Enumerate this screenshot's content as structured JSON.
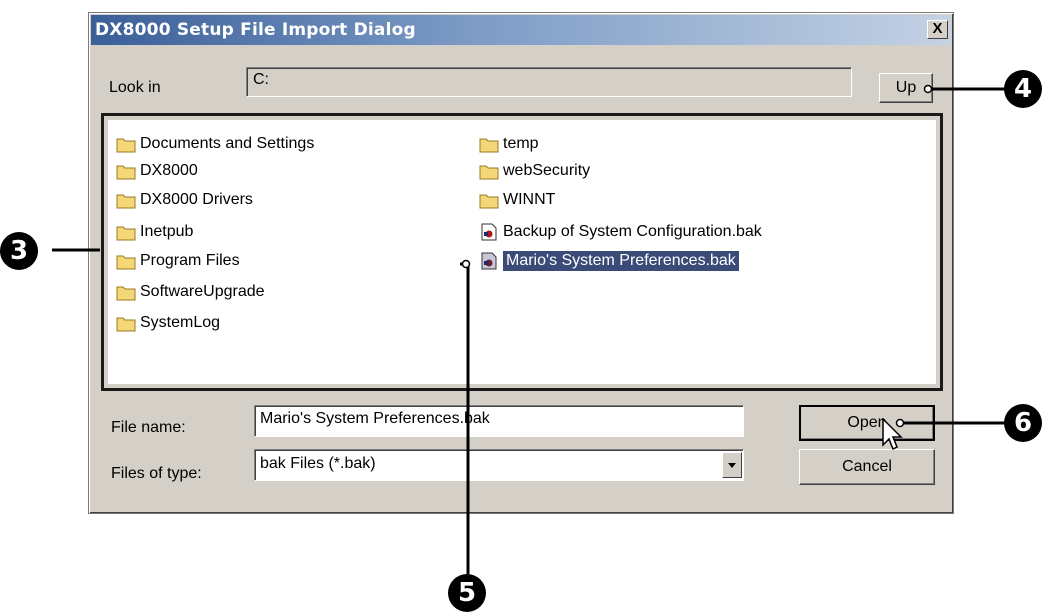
{
  "dialog": {
    "title": "DX8000 Setup File Import Dialog",
    "close_label": "X"
  },
  "look_in": {
    "label": "Look in",
    "value": "C:",
    "up_label": "Up"
  },
  "files": {
    "items": [
      {
        "name": "Documents and Settings",
        "type": "folder"
      },
      {
        "name": "DX8000",
        "type": "folder"
      },
      {
        "name": "DX8000 Drivers",
        "type": "folder"
      },
      {
        "name": "Inetpub",
        "type": "folder"
      },
      {
        "name": "Program Files",
        "type": "folder"
      },
      {
        "name": "SoftwareUpgrade",
        "type": "folder"
      },
      {
        "name": "SystemLog",
        "type": "folder"
      },
      {
        "name": "temp",
        "type": "folder"
      },
      {
        "name": "webSecurity",
        "type": "folder"
      },
      {
        "name": "WINNT",
        "type": "folder"
      },
      {
        "name": "Backup of System Configuration.bak",
        "type": "bak-file"
      },
      {
        "name": "Mario's System Preferences.bak",
        "type": "bak-file",
        "selected": true
      }
    ]
  },
  "file_name": {
    "label": "File name:",
    "value": "Mario's System Preferences.bak"
  },
  "file_type": {
    "label": "Files of type:",
    "value": "bak Files (*.bak)"
  },
  "buttons": {
    "open": "Open",
    "cancel": "Cancel"
  },
  "callouts": {
    "file_list": "3",
    "up_button": "4",
    "selected_file": "5",
    "open_button": "6"
  },
  "colors": {
    "title_gradient_start": "#3a5e98",
    "title_gradient_end": "#c4d2e4",
    "selection": "#3a4b78",
    "dialog_face": "#d4d0c8"
  }
}
